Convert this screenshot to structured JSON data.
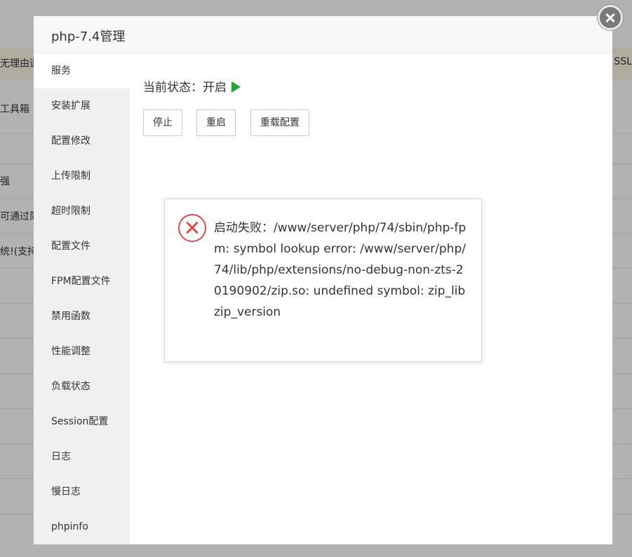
{
  "background": {
    "rows": [
      {
        "left": "无理由退",
        "right": "SSL"
      },
      {
        "left": "工具箱",
        "right": ""
      },
      {
        "left": "强",
        "right": ""
      },
      {
        "left": "可通过简",
        "right": ""
      },
      {
        "left": "统!(支持",
        "right": ""
      }
    ]
  },
  "modal": {
    "title": "php-7.4管理",
    "sidebar": [
      "服务",
      "安装扩展",
      "配置修改",
      "上传限制",
      "超时限制",
      "配置文件",
      "FPM配置文件",
      "禁用函数",
      "性能调整",
      "负载状态",
      "Session配置",
      "日志",
      "慢日志",
      "phpinfo"
    ],
    "status": {
      "label": "当前状态：",
      "value": "开启"
    },
    "buttons": {
      "stop": "停止",
      "restart": "重启",
      "reload": "重载配置"
    },
    "status_color": "#20a53a"
  },
  "error_dialog": {
    "message": "启动失败：/www/server/php/74/sbin/php-fpm: symbol lookup error: /www/server/php/74/lib/php/extensions/no-debug-non-zts-20190902/zip.so: undefined symbol: zip_libzip_version",
    "icon_color": "#e04c4c"
  },
  "icons": {
    "close": "close-icon",
    "error": "error-x-icon",
    "status": "play-icon"
  }
}
